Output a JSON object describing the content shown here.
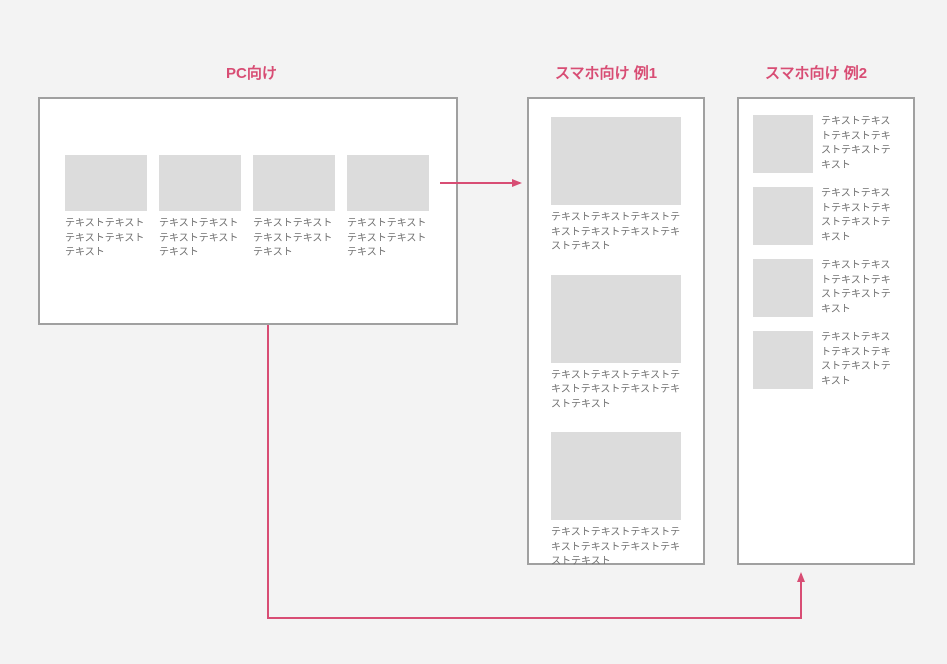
{
  "headings": {
    "pc": "PC向け",
    "sp1": "スマホ向け 例1",
    "sp2": "スマホ向け 例2"
  },
  "pc": {
    "items": [
      {
        "caption": "テキストテキストテキストテキストテキスト"
      },
      {
        "caption": "テキストテキストテキストテキストテキスト"
      },
      {
        "caption": "テキストテキストテキストテキストテキスト"
      },
      {
        "caption": "テキストテキストテキストテキストテキスト"
      }
    ]
  },
  "sp1": {
    "items": [
      {
        "caption": "テキストテキストテキストテキストテキストテキストテキストテキスト"
      },
      {
        "caption": "テキストテキストテキストテキストテキストテキストテキストテキスト"
      },
      {
        "caption": "テキストテキストテキストテキストテキストテキストテキストテキスト"
      }
    ]
  },
  "sp2": {
    "items": [
      {
        "caption": "テキストテキストテキストテキストテキストテキスト"
      },
      {
        "caption": "テキストテキストテキストテキストテキストテキスト"
      },
      {
        "caption": "テキストテキストテキストテキストテキストテキスト"
      },
      {
        "caption": "テキストテキストテキストテキストテキストテキスト"
      }
    ]
  }
}
